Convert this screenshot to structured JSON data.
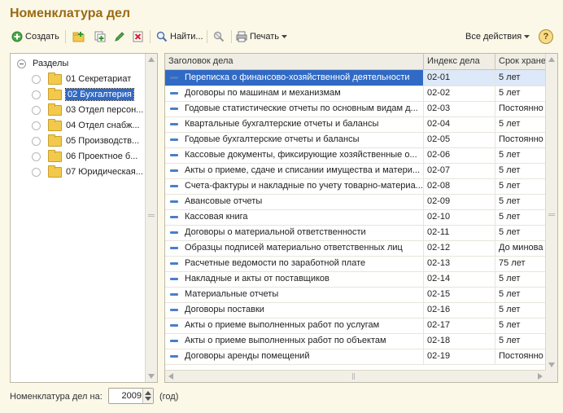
{
  "page": {
    "title": "Номенклатура дел"
  },
  "toolbar": {
    "create_label": "Создать",
    "find_label": "Найти...",
    "print_label": "Печать",
    "all_actions_label": "Все действия",
    "help_label": "?"
  },
  "tree": {
    "root_label": "Разделы",
    "items": [
      {
        "label": "01 Секретариат"
      },
      {
        "label": "02 Бухгалтерия"
      },
      {
        "label": "03 Отдел персон..."
      },
      {
        "label": "04 Отдел снабж..."
      },
      {
        "label": "05 Производств..."
      },
      {
        "label": "06 Проектное б..."
      },
      {
        "label": "07 Юридическая..."
      }
    ]
  },
  "grid": {
    "columns": [
      "Заголовок дела",
      "Индекс дела",
      "Срок хране"
    ],
    "rows": [
      {
        "title": "Переписка о финансово-хозяйственной деятельности",
        "index": "02-01",
        "term": "5 лет"
      },
      {
        "title": "Договоры по машинам и механизмам",
        "index": "02-02",
        "term": "5 лет"
      },
      {
        "title": "Годовые статистические отчеты по основным видам д...",
        "index": "02-03",
        "term": "Постоянно"
      },
      {
        "title": "Квартальные бухгалтерские отчеты и балансы",
        "index": "02-04",
        "term": "5 лет"
      },
      {
        "title": "Годовые бухгалтерские отчеты и балансы",
        "index": "02-05",
        "term": "Постоянно"
      },
      {
        "title": "Кассовые документы, фиксирующие хозяйственные о...",
        "index": "02-06",
        "term": "5 лет"
      },
      {
        "title": "Акты о приеме, сдаче и списании имущества и матери...",
        "index": "02-07",
        "term": "5 лет"
      },
      {
        "title": "Счета-фактуры и накладные по учету товарно-материа...",
        "index": "02-08",
        "term": "5 лет"
      },
      {
        "title": "Авансовые отчеты",
        "index": "02-09",
        "term": "5 лет"
      },
      {
        "title": "Кассовая книга",
        "index": "02-10",
        "term": "5 лет"
      },
      {
        "title": "Договоры о материальной ответственности",
        "index": "02-11",
        "term": "5 лет"
      },
      {
        "title": "Образцы подписей материально ответственных лиц",
        "index": "02-12",
        "term": "До минова"
      },
      {
        "title": "Расчетные ведомости по заработной плате",
        "index": "02-13",
        "term": "75 лет"
      },
      {
        "title": "Накладные и акты от поставщиков",
        "index": "02-14",
        "term": "5 лет"
      },
      {
        "title": "Материальные отчеты",
        "index": "02-15",
        "term": "5 лет"
      },
      {
        "title": "Договоры поставки",
        "index": "02-16",
        "term": "5 лет"
      },
      {
        "title": "Акты о приеме выполненных работ по услугам",
        "index": "02-17",
        "term": "5 лет"
      },
      {
        "title": "Акты о приеме выполненных работ по объектам",
        "index": "02-18",
        "term": "5 лет"
      },
      {
        "title": "Договоры аренды помещений",
        "index": "02-19",
        "term": "Постоянно"
      }
    ]
  },
  "footer": {
    "label": "Номенклатура дел на:",
    "year": "2009",
    "suffix": "(год)"
  },
  "colors": {
    "title": "#9b6a10",
    "background": "#fbf8e8",
    "selection": "#316ac5"
  }
}
